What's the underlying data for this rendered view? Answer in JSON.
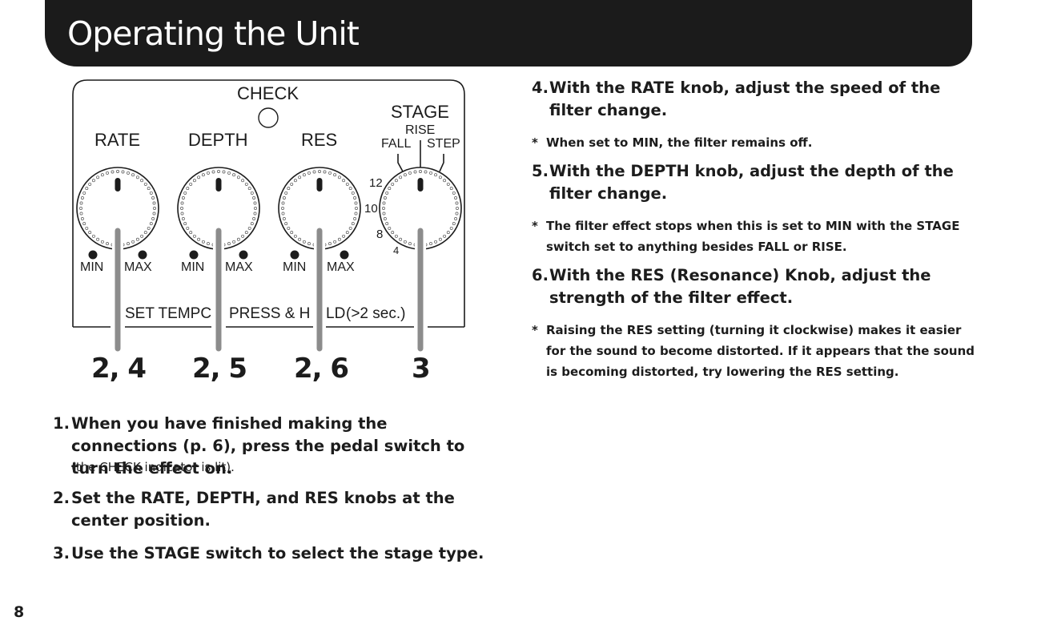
{
  "header": {
    "title": "Operating the Unit"
  },
  "diagram": {
    "check_label": "CHECK",
    "stage_label": "STAGE",
    "stage_positions": {
      "rise": "RISE",
      "fall": "FALL",
      "step": "STEP"
    },
    "stage_scale": [
      "12",
      "10",
      "8",
      "4"
    ],
    "knobs": [
      {
        "label": "RATE",
        "min": "MIN",
        "max": "MAX",
        "callout": "2, 4"
      },
      {
        "label": "DEPTH",
        "min": "MIN",
        "max": "MAX",
        "callout": "2, 5"
      },
      {
        "label": "RES",
        "min": "MIN",
        "max": "MAX",
        "callout": "2, 6"
      },
      {
        "label": "STAGE",
        "callout": "3"
      }
    ],
    "bottom_labels": {
      "set_tempo": "SET TEMPC",
      "press_hold_a": "PRESS & H",
      "press_hold_b": "LD",
      "press_hold_c": "(>2 sec.)"
    },
    "colors": {
      "callout_line": "#8c8c8c",
      "panel_stroke": "#1c1c1c"
    }
  },
  "steps_left": [
    {
      "num": "1.",
      "text": "When you have finished making the connections (p. 6), press the pedal switch to turn the effect on."
    },
    {
      "num": "2.",
      "text": "Set the RATE, DEPTH, and RES knobs at the center position."
    },
    {
      "num": "3.",
      "text": "Use the STAGE switch to select the stage type."
    }
  ],
  "step1_subnote": "(the CHECK indicator is lit).",
  "steps_right": [
    {
      "num": "4.",
      "text": "With the RATE knob, adjust the speed of the filter change."
    },
    {
      "num": "5.",
      "text": "With the DEPTH knob, adjust the depth of the filter change."
    },
    {
      "num": "6.",
      "text": "With the RES (Resonance) Knob, adjust the strength of the filter effect."
    }
  ],
  "notes": [
    {
      "star": "*",
      "text": "When set to MIN, the filter remains off."
    },
    {
      "star": "*",
      "text": "The filter effect stops when this is set to MIN with the STAGE switch set to anything besides FALL or RISE."
    },
    {
      "star": "*",
      "text": "Raising the RES setting (turning it clockwise) makes it easier for the sound to become distorted. If it appears that the sound is becoming distorted, try lowering the RES setting."
    }
  ],
  "footer": {
    "page_number": "8"
  }
}
